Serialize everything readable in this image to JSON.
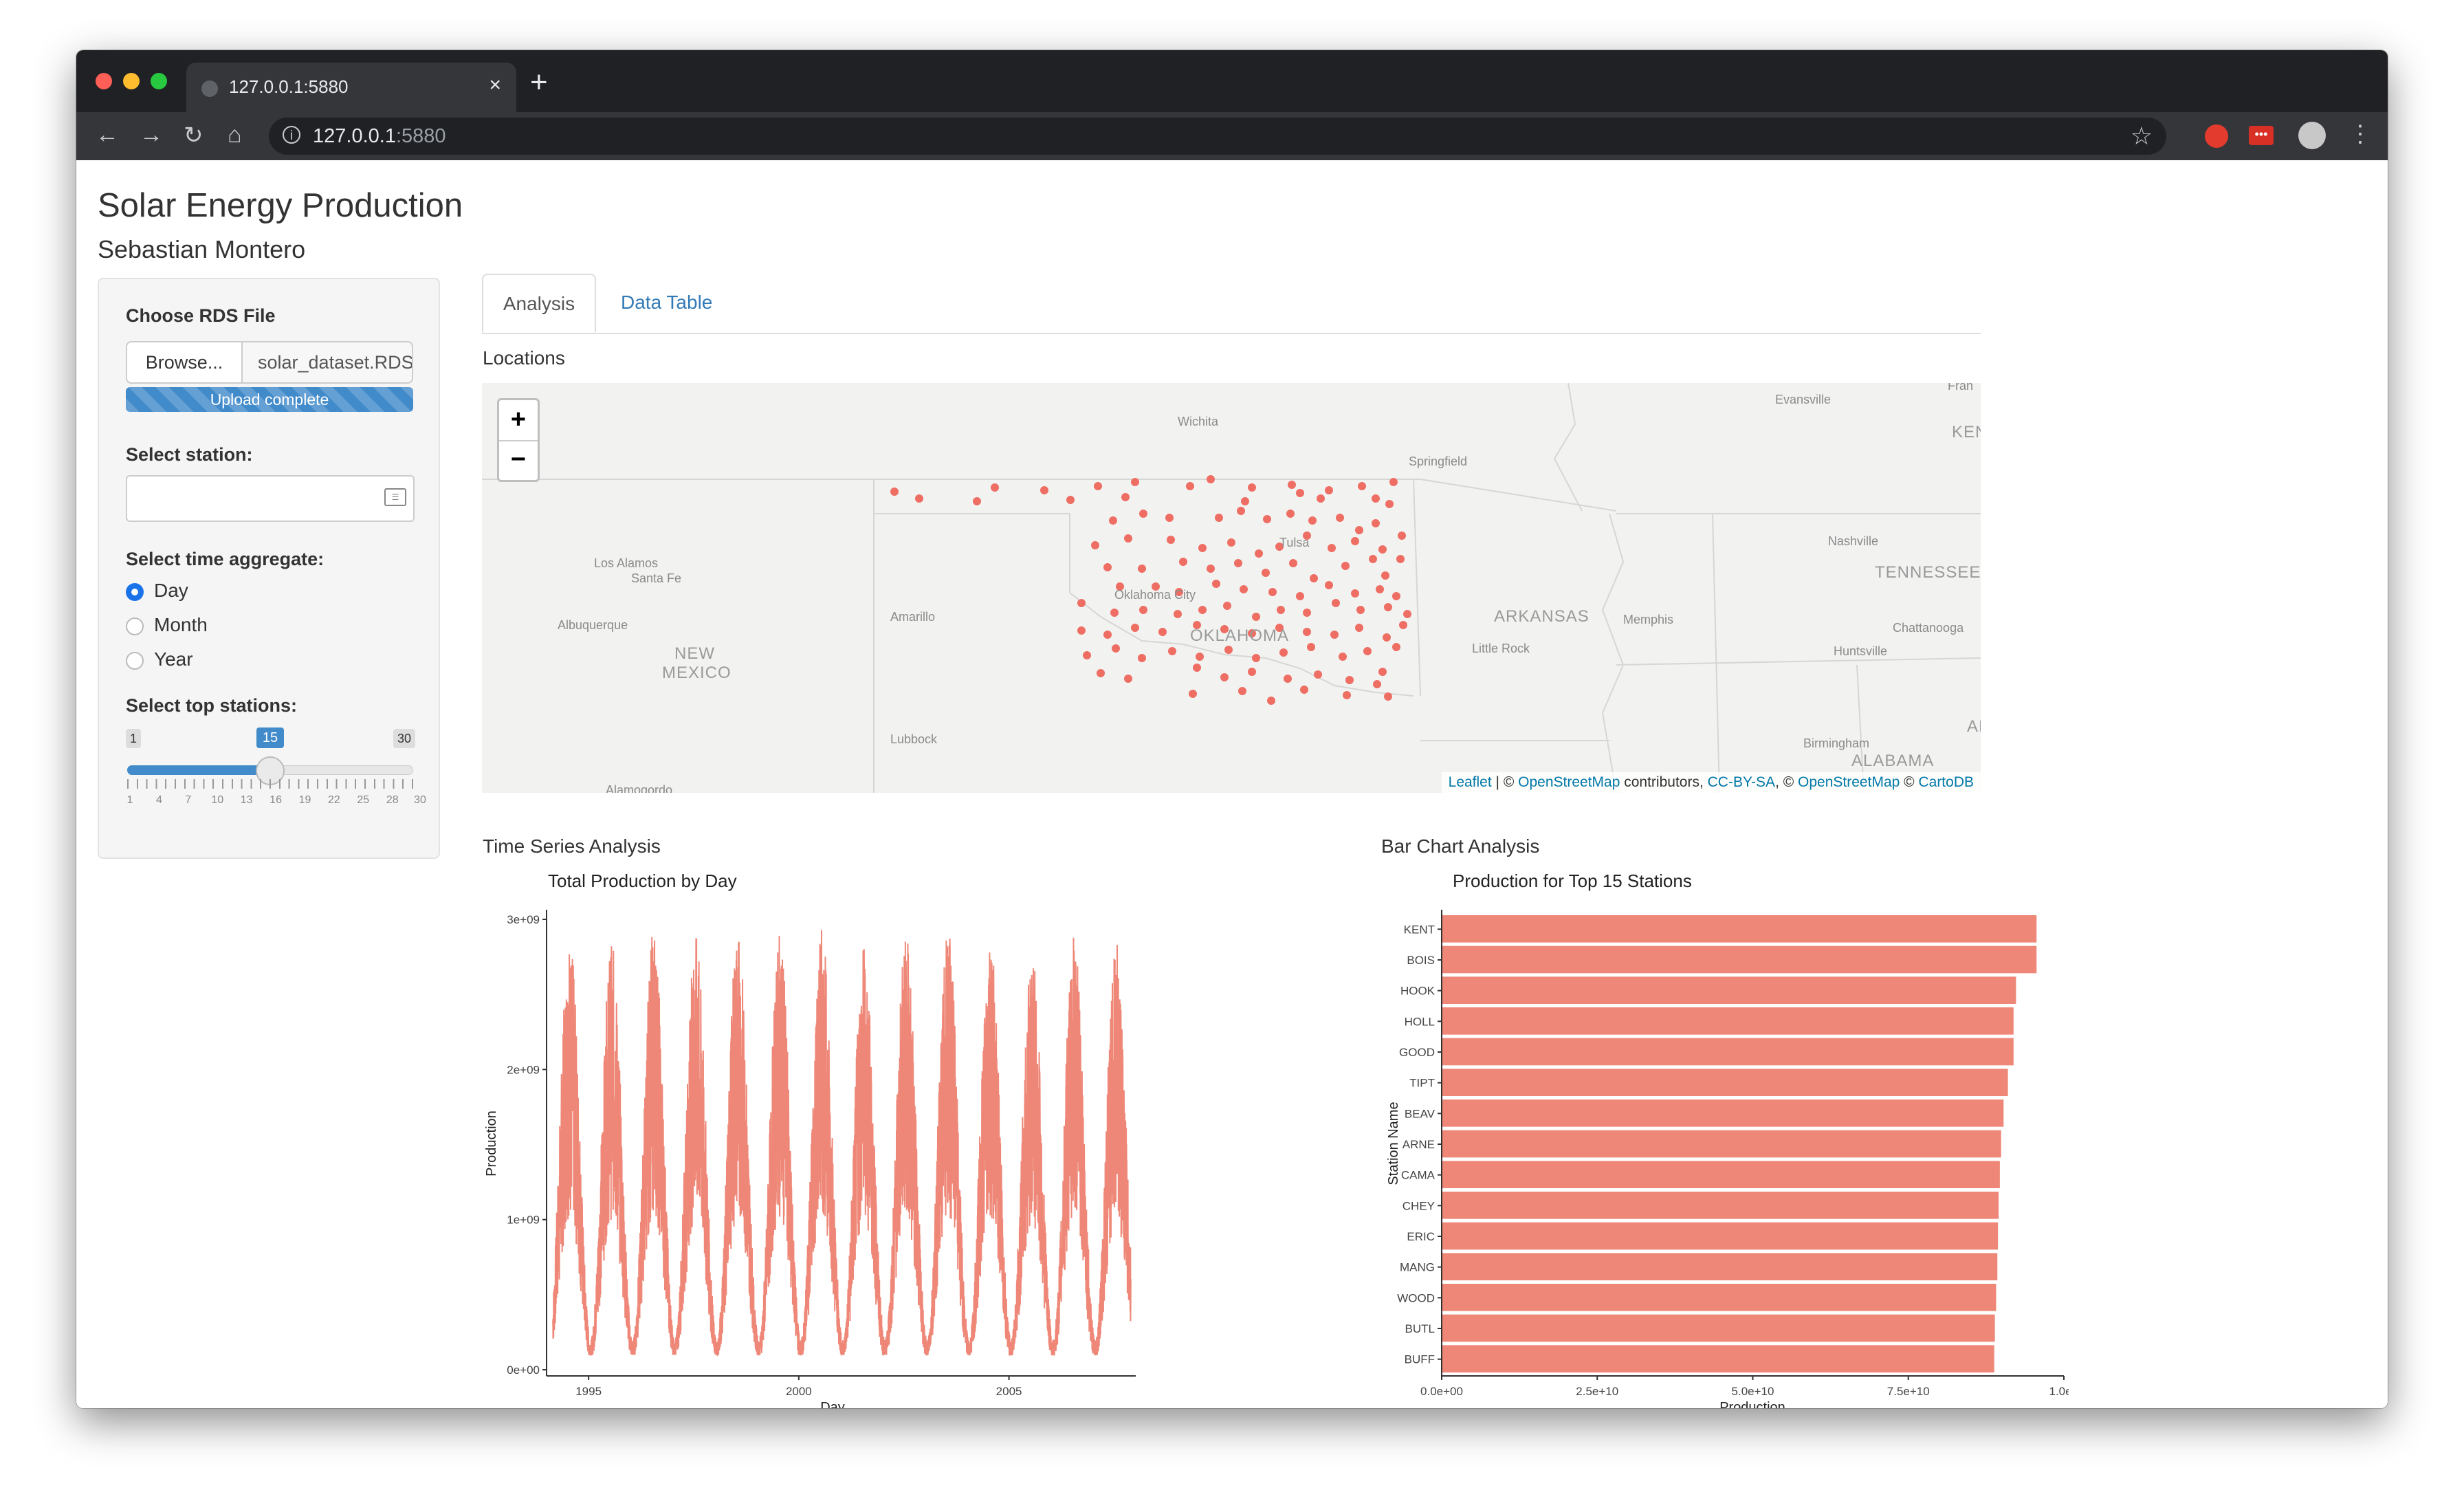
{
  "browser": {
    "tab_title": "127.0.0.1:5880",
    "url_host": "127.0.0.1",
    "url_port": ":5880"
  },
  "header": {
    "title": "Solar Energy Production",
    "author": "Sebastian Montero"
  },
  "sidebar": {
    "file_label": "Choose RDS File",
    "browse_label": "Browse...",
    "file_name": "solar_dataset.RDS",
    "upload_status": "Upload complete",
    "station_label": "Select station:",
    "aggregate_label": "Select time aggregate:",
    "aggregate_options": [
      "Day",
      "Month",
      "Year"
    ],
    "aggregate_selected": "Day",
    "top_label": "Select top stations:",
    "slider": {
      "min": "1",
      "max": "30",
      "value": "15",
      "ticks": [
        "1",
        "4",
        "7",
        "10",
        "13",
        "16",
        "19",
        "22",
        "25",
        "28",
        "30"
      ]
    }
  },
  "tabs": [
    "Analysis",
    "Data Table"
  ],
  "map": {
    "section_title": "Locations",
    "zoom_in": "+",
    "zoom_out": "−",
    "labels": {
      "wichita": "Wichita",
      "springfield": "Springfield",
      "evansville": "Evansville",
      "ken": "KEN",
      "frank": "Fran",
      "los_alamos": "Los Alamos",
      "santa_fe": "Santa Fe",
      "tulsa": "Tulsa",
      "nashville": "Nashville",
      "tennessee": "TENNESSEE",
      "albuquerque": "Albuquerque",
      "amarillo": "Amarillo",
      "okc": "Oklahoma City",
      "oklahoma": "OKLAHOMA",
      "arkansas": "ARKANSAS",
      "memphis": "Memphis",
      "chattanooga": "Chattanooga",
      "new_mexico_1": "NEW",
      "new_mexico_2": "MEXICO",
      "little_rock": "Little Rock",
      "huntsville": "Huntsville",
      "lubbock": "Lubbock",
      "birmingham": "Birmingham",
      "alabama": "ALABAMA",
      "al": "AL",
      "alamogordo": "Alamogordo"
    },
    "attribution": {
      "leaflet": "Leaflet",
      "sep1": " | © ",
      "osm": "OpenStreetMap",
      "contributors": " contributors, ",
      "ccbysa": "CC-BY-SA",
      "sep2": ", © ",
      "osm2": "OpenStreetMap",
      "sep3": " © ",
      "carto": "CartoDB"
    }
  },
  "time_series": {
    "section_title": "Time Series Analysis",
    "chart_title": "Total Production by Day",
    "y_axis_label": "Production",
    "x_axis_label": "Day",
    "y_ticks": [
      "0e+00",
      "1e+09",
      "2e+09",
      "3e+09"
    ],
    "x_ticks": [
      "1995",
      "2000",
      "2005"
    ],
    "color": "#ee8777"
  },
  "bar_chart": {
    "section_title": "Bar Chart Analysis",
    "x_ticks": [
      "0.0e+00",
      "2.5e+10",
      "5.0e+10",
      "7.5e+10",
      "1.0e+"
    ],
    "color": "#ee8777"
  },
  "chart_data": [
    {
      "type": "line",
      "title": "Total Production by Day",
      "xlabel": "Day",
      "ylabel": "Production",
      "xlim": [
        1994,
        2008
      ],
      "ylim": [
        0,
        3000000000
      ],
      "peaks": [
        {
          "year": 1994.55,
          "value": 2900000000
        },
        {
          "year": 1995.55,
          "value": 2850000000
        },
        {
          "year": 1996.55,
          "value": 2950000000
        },
        {
          "year": 1997.55,
          "value": 2900000000
        },
        {
          "year": 1998.55,
          "value": 2950000000
        },
        {
          "year": 1999.55,
          "value": 2900000000
        },
        {
          "year": 2000.55,
          "value": 2950000000
        },
        {
          "year": 2001.55,
          "value": 2850000000
        },
        {
          "year": 2002.55,
          "value": 2900000000
        },
        {
          "year": 2003.55,
          "value": 2950000000
        },
        {
          "year": 2004.55,
          "value": 2900000000
        },
        {
          "year": 2005.55,
          "value": 2800000000
        },
        {
          "year": 2006.55,
          "value": 2900000000
        },
        {
          "year": 2007.55,
          "value": 2850000000
        }
      ],
      "trough_value": 200000000
    },
    {
      "type": "bar",
      "title": "Production for Top 15 Stations",
      "xlabel": "Production",
      "ylabel": "Station Name",
      "xlim": [
        0,
        100000000000
      ],
      "categories": [
        "KENT",
        "BOIS",
        "HOOK",
        "HOLL",
        "GOOD",
        "TIPT",
        "BEAV",
        "ARNE",
        "CAMA",
        "CHEY",
        "ERIC",
        "MANG",
        "WOOD",
        "BUTL",
        "BUFF"
      ],
      "values": [
        95500000000,
        95500000000,
        92200000000,
        91800000000,
        91800000000,
        90900000000,
        90200000000,
        89800000000,
        89600000000,
        89400000000,
        89300000000,
        89200000000,
        89000000000,
        88800000000,
        88700000000
      ]
    }
  ]
}
